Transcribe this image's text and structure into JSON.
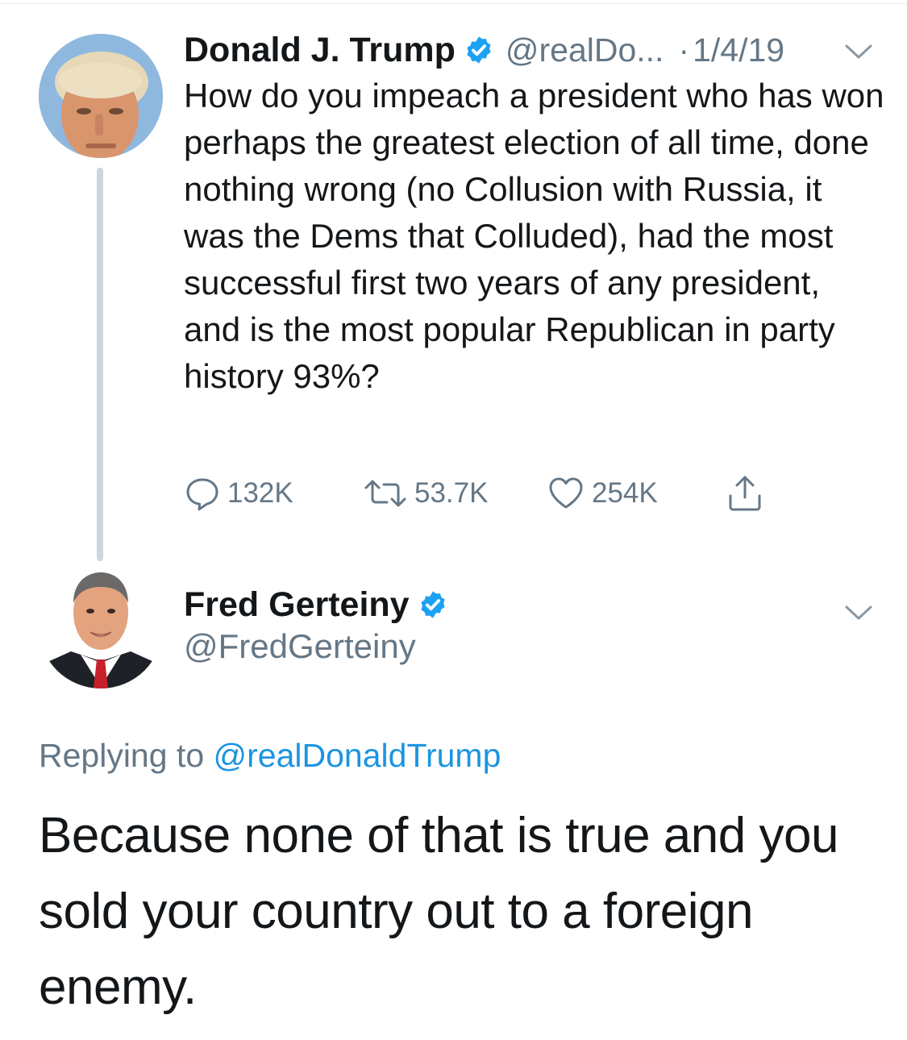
{
  "tweet": {
    "author_name": "Donald J. Trump",
    "handle": "@realDo...",
    "separator": "·",
    "date": "1/4/19",
    "text": "How do you impeach a president who has won perhaps the greatest election of all time, done nothing wrong (no Collusion with Russia, it was the Dems that Colluded), had the most successful first two years of any president, and is the most popular Republican in party history 93%?",
    "actions": {
      "replies": "132K",
      "retweets": "53.7K",
      "likes": "254K"
    }
  },
  "reply": {
    "author_name": "Fred Gerteiny",
    "handle": "@FredGerteiny",
    "replying_prefix": "Replying to",
    "replying_mention": "@realDonaldTrump",
    "text": "Because none of that is true and you sold your country out to a foreign enemy."
  },
  "icons": {
    "verified": "verified-badge-icon",
    "chevron": "chevron-down-icon",
    "reply": "reply-icon",
    "retweet": "retweet-icon",
    "like": "heart-icon",
    "share": "share-icon"
  },
  "colors": {
    "text_primary": "#14171a",
    "text_secondary": "#657786",
    "link": "#1b95e0",
    "verified": "#1da1f2",
    "thread_line": "#ccd6dd"
  }
}
